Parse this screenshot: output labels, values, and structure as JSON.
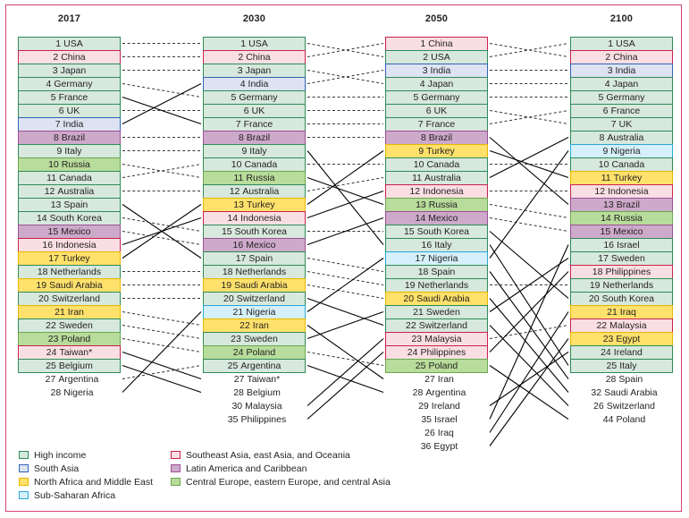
{
  "figure": {
    "headers": [
      "2017",
      "2030",
      "2050",
      "2100"
    ]
  },
  "legend": {
    "items": [
      {
        "label": "High income",
        "key": "high",
        "color": "#d7e8dd",
        "border": "#2e8b57"
      },
      {
        "label": "Southeast Asia, east Asia, and Oceania",
        "key": "sea",
        "color": "#f9dfe3",
        "border": "#c9214b"
      },
      {
        "label": "South Asia",
        "key": "south",
        "color": "#dde3f2",
        "border": "#2f64b5"
      },
      {
        "label": "Latin America and Caribbean",
        "key": "latam",
        "color": "#cda9ca",
        "border": "#9d4f96"
      },
      {
        "label": "North Africa and Middle East",
        "key": "nafr",
        "color": "#ffe16b",
        "border": "#e8b700"
      },
      {
        "label": "Central Europe, eastern Europe, and central Asia",
        "key": "ceur",
        "color": "#b8dc9b",
        "border": "#6aa84f"
      },
      {
        "label": "Sub-Saharan Africa",
        "key": "subs",
        "color": "#d5f0fa",
        "border": "#29a8d8"
      }
    ]
  },
  "chart_data": {
    "type": "table",
    "title": "",
    "columns": [
      "2017",
      "2030",
      "2050",
      "2100"
    ],
    "note": "Ranked list of countries by GDP for each year; boxes coloured by world region; connector lines track each country between years",
    "series": [
      {
        "name": "2017",
        "values": [
          {
            "rank": "1",
            "country": "USA",
            "cat": "high",
            "boxed": true
          },
          {
            "rank": "2",
            "country": "China",
            "cat": "sea",
            "boxed": true
          },
          {
            "rank": "3",
            "country": "Japan",
            "cat": "high",
            "boxed": true
          },
          {
            "rank": "4",
            "country": "Germany",
            "cat": "high",
            "boxed": true
          },
          {
            "rank": "5",
            "country": "France",
            "cat": "high",
            "boxed": true
          },
          {
            "rank": "6",
            "country": "UK",
            "cat": "high",
            "boxed": true
          },
          {
            "rank": "7",
            "country": "India",
            "cat": "south",
            "boxed": true
          },
          {
            "rank": "8",
            "country": "Brazil",
            "cat": "latam",
            "boxed": true
          },
          {
            "rank": "9",
            "country": "Italy",
            "cat": "high",
            "boxed": true
          },
          {
            "rank": "10",
            "country": "Russia",
            "cat": "ceur",
            "boxed": true
          },
          {
            "rank": "11",
            "country": "Canada",
            "cat": "high",
            "boxed": true
          },
          {
            "rank": "12",
            "country": "Australia",
            "cat": "high",
            "boxed": true
          },
          {
            "rank": "13",
            "country": "Spain",
            "cat": "high",
            "boxed": true
          },
          {
            "rank": "14",
            "country": "South Korea",
            "cat": "high",
            "boxed": true
          },
          {
            "rank": "15",
            "country": "Mexico",
            "cat": "latam",
            "boxed": true
          },
          {
            "rank": "16",
            "country": "Indonesia",
            "cat": "sea",
            "boxed": true
          },
          {
            "rank": "17",
            "country": "Turkey",
            "cat": "nafr",
            "boxed": true
          },
          {
            "rank": "18",
            "country": "Netherlands",
            "cat": "high",
            "boxed": true
          },
          {
            "rank": "19",
            "country": "Saudi Arabia",
            "cat": "nafr",
            "boxed": true
          },
          {
            "rank": "20",
            "country": "Switzerland",
            "cat": "high",
            "boxed": true
          },
          {
            "rank": "21",
            "country": "Iran",
            "cat": "nafr",
            "boxed": true
          },
          {
            "rank": "22",
            "country": "Sweden",
            "cat": "high",
            "boxed": true
          },
          {
            "rank": "23",
            "country": "Poland",
            "cat": "ceur",
            "boxed": true
          },
          {
            "rank": "24",
            "country": "Taiwan*",
            "cat": "sea",
            "boxed": true
          },
          {
            "rank": "25",
            "country": "Belgium",
            "cat": "high",
            "boxed": true
          },
          {
            "rank": "27",
            "country": "Argentina",
            "cat": "none",
            "boxed": false
          },
          {
            "rank": "28",
            "country": "Nigeria",
            "cat": "none",
            "boxed": false
          }
        ]
      },
      {
        "name": "2030",
        "values": [
          {
            "rank": "1",
            "country": "USA",
            "cat": "high",
            "boxed": true
          },
          {
            "rank": "2",
            "country": "China",
            "cat": "sea",
            "boxed": true
          },
          {
            "rank": "3",
            "country": "Japan",
            "cat": "high",
            "boxed": true
          },
          {
            "rank": "4",
            "country": "India",
            "cat": "south",
            "boxed": true
          },
          {
            "rank": "5",
            "country": "Germany",
            "cat": "high",
            "boxed": true
          },
          {
            "rank": "6",
            "country": "UK",
            "cat": "high",
            "boxed": true
          },
          {
            "rank": "7",
            "country": "France",
            "cat": "high",
            "boxed": true
          },
          {
            "rank": "8",
            "country": "Brazil",
            "cat": "latam",
            "boxed": true
          },
          {
            "rank": "9",
            "country": "Italy",
            "cat": "high",
            "boxed": true
          },
          {
            "rank": "10",
            "country": "Canada",
            "cat": "high",
            "boxed": true
          },
          {
            "rank": "11",
            "country": "Russia",
            "cat": "ceur",
            "boxed": true
          },
          {
            "rank": "12",
            "country": "Australia",
            "cat": "high",
            "boxed": true
          },
          {
            "rank": "13",
            "country": "Turkey",
            "cat": "nafr",
            "boxed": true
          },
          {
            "rank": "14",
            "country": "Indonesia",
            "cat": "sea",
            "boxed": true
          },
          {
            "rank": "15",
            "country": "South Korea",
            "cat": "high",
            "boxed": true
          },
          {
            "rank": "16",
            "country": "Mexico",
            "cat": "latam",
            "boxed": true
          },
          {
            "rank": "17",
            "country": "Spain",
            "cat": "high",
            "boxed": true
          },
          {
            "rank": "18",
            "country": "Netherlands",
            "cat": "high",
            "boxed": true
          },
          {
            "rank": "19",
            "country": "Saudi Arabia",
            "cat": "nafr",
            "boxed": true
          },
          {
            "rank": "20",
            "country": "Switzerland",
            "cat": "high",
            "boxed": true
          },
          {
            "rank": "21",
            "country": "Nigeria",
            "cat": "subs",
            "boxed": true
          },
          {
            "rank": "22",
            "country": "Iran",
            "cat": "nafr",
            "boxed": true
          },
          {
            "rank": "23",
            "country": "Sweden",
            "cat": "high",
            "boxed": true
          },
          {
            "rank": "24",
            "country": "Poland",
            "cat": "ceur",
            "boxed": true
          },
          {
            "rank": "25",
            "country": "Argentina",
            "cat": "high",
            "boxed": true
          },
          {
            "rank": "27",
            "country": "Taiwan*",
            "cat": "none",
            "boxed": false
          },
          {
            "rank": "28",
            "country": "Belgium",
            "cat": "none",
            "boxed": false
          },
          {
            "rank": "30",
            "country": "Malaysia",
            "cat": "none",
            "boxed": false
          },
          {
            "rank": "35",
            "country": "Philippines",
            "cat": "none",
            "boxed": false
          }
        ]
      },
      {
        "name": "2050",
        "values": [
          {
            "rank": "1",
            "country": "China",
            "cat": "sea",
            "boxed": true
          },
          {
            "rank": "2",
            "country": "USA",
            "cat": "high",
            "boxed": true
          },
          {
            "rank": "3",
            "country": "India",
            "cat": "south",
            "boxed": true
          },
          {
            "rank": "4",
            "country": "Japan",
            "cat": "high",
            "boxed": true
          },
          {
            "rank": "5",
            "country": "Germany",
            "cat": "high",
            "boxed": true
          },
          {
            "rank": "6",
            "country": "UK",
            "cat": "high",
            "boxed": true
          },
          {
            "rank": "7",
            "country": "France",
            "cat": "high",
            "boxed": true
          },
          {
            "rank": "8",
            "country": "Brazil",
            "cat": "latam",
            "boxed": true
          },
          {
            "rank": "9",
            "country": "Turkey",
            "cat": "nafr",
            "boxed": true
          },
          {
            "rank": "10",
            "country": "Canada",
            "cat": "high",
            "boxed": true
          },
          {
            "rank": "11",
            "country": "Australia",
            "cat": "high",
            "boxed": true
          },
          {
            "rank": "12",
            "country": "Indonesia",
            "cat": "sea",
            "boxed": true
          },
          {
            "rank": "13",
            "country": "Russia",
            "cat": "ceur",
            "boxed": true
          },
          {
            "rank": "14",
            "country": "Mexico",
            "cat": "latam",
            "boxed": true
          },
          {
            "rank": "15",
            "country": "South Korea",
            "cat": "high",
            "boxed": true
          },
          {
            "rank": "16",
            "country": "Italy",
            "cat": "high",
            "boxed": true
          },
          {
            "rank": "17",
            "country": "Nigeria",
            "cat": "subs",
            "boxed": true
          },
          {
            "rank": "18",
            "country": "Spain",
            "cat": "high",
            "boxed": true
          },
          {
            "rank": "19",
            "country": "Netherlands",
            "cat": "high",
            "boxed": true
          },
          {
            "rank": "20",
            "country": "Saudi Arabia",
            "cat": "nafr",
            "boxed": true
          },
          {
            "rank": "21",
            "country": "Sweden",
            "cat": "high",
            "boxed": true
          },
          {
            "rank": "22",
            "country": "Switzerland",
            "cat": "high",
            "boxed": true
          },
          {
            "rank": "23",
            "country": "Malaysia",
            "cat": "sea",
            "boxed": true
          },
          {
            "rank": "24",
            "country": "Philippines",
            "cat": "sea",
            "boxed": true
          },
          {
            "rank": "25",
            "country": "Poland",
            "cat": "ceur",
            "boxed": true
          },
          {
            "rank": "27",
            "country": "Iran",
            "cat": "none",
            "boxed": false
          },
          {
            "rank": "28",
            "country": "Argentina",
            "cat": "none",
            "boxed": false
          },
          {
            "rank": "29",
            "country": "Ireland",
            "cat": "none",
            "boxed": false
          },
          {
            "rank": "35",
            "country": "Israel",
            "cat": "none",
            "boxed": false
          },
          {
            "rank": "26",
            "country": "Iraq",
            "cat": "none",
            "boxed": false
          },
          {
            "rank": "36",
            "country": "Egypt",
            "cat": "none",
            "boxed": false
          }
        ]
      },
      {
        "name": "2100",
        "values": [
          {
            "rank": "1",
            "country": "USA",
            "cat": "high",
            "boxed": true
          },
          {
            "rank": "2",
            "country": "China",
            "cat": "sea",
            "boxed": true
          },
          {
            "rank": "3",
            "country": "India",
            "cat": "south",
            "boxed": true
          },
          {
            "rank": "4",
            "country": "Japan",
            "cat": "high",
            "boxed": true
          },
          {
            "rank": "5",
            "country": "Germany",
            "cat": "high",
            "boxed": true
          },
          {
            "rank": "6",
            "country": "France",
            "cat": "high",
            "boxed": true
          },
          {
            "rank": "7",
            "country": "UK",
            "cat": "high",
            "boxed": true
          },
          {
            "rank": "8",
            "country": "Australia",
            "cat": "high",
            "boxed": true
          },
          {
            "rank": "9",
            "country": "Nigeria",
            "cat": "subs",
            "boxed": true
          },
          {
            "rank": "10",
            "country": "Canada",
            "cat": "high",
            "boxed": true
          },
          {
            "rank": "11",
            "country": "Turkey",
            "cat": "nafr",
            "boxed": true
          },
          {
            "rank": "12",
            "country": "Indonesia",
            "cat": "sea",
            "boxed": true
          },
          {
            "rank": "13",
            "country": "Brazil",
            "cat": "latam",
            "boxed": true
          },
          {
            "rank": "14",
            "country": "Russia",
            "cat": "ceur",
            "boxed": true
          },
          {
            "rank": "15",
            "country": "Mexico",
            "cat": "latam",
            "boxed": true
          },
          {
            "rank": "16",
            "country": "Israel",
            "cat": "high",
            "boxed": true
          },
          {
            "rank": "17",
            "country": "Sweden",
            "cat": "high",
            "boxed": true
          },
          {
            "rank": "18",
            "country": "Philippines",
            "cat": "sea",
            "boxed": true
          },
          {
            "rank": "19",
            "country": "Netherlands",
            "cat": "high",
            "boxed": true
          },
          {
            "rank": "20",
            "country": "South Korea",
            "cat": "high",
            "boxed": true
          },
          {
            "rank": "21",
            "country": "Iraq",
            "cat": "nafr",
            "boxed": true
          },
          {
            "rank": "22",
            "country": "Malaysia",
            "cat": "sea",
            "boxed": true
          },
          {
            "rank": "23",
            "country": "Egypt",
            "cat": "nafr",
            "boxed": true
          },
          {
            "rank": "24",
            "country": "Ireland",
            "cat": "high",
            "boxed": true
          },
          {
            "rank": "25",
            "country": "Italy",
            "cat": "high",
            "boxed": true
          },
          {
            "rank": "28",
            "country": "Spain",
            "cat": "none",
            "boxed": false
          },
          {
            "rank": "32",
            "country": "Saudi Arabia",
            "cat": "none",
            "boxed": false
          },
          {
            "rank": "26",
            "country": "Switzerland",
            "cat": "none",
            "boxed": false
          },
          {
            "rank": "44",
            "country": "Poland",
            "cat": "none",
            "boxed": false
          }
        ]
      }
    ]
  }
}
